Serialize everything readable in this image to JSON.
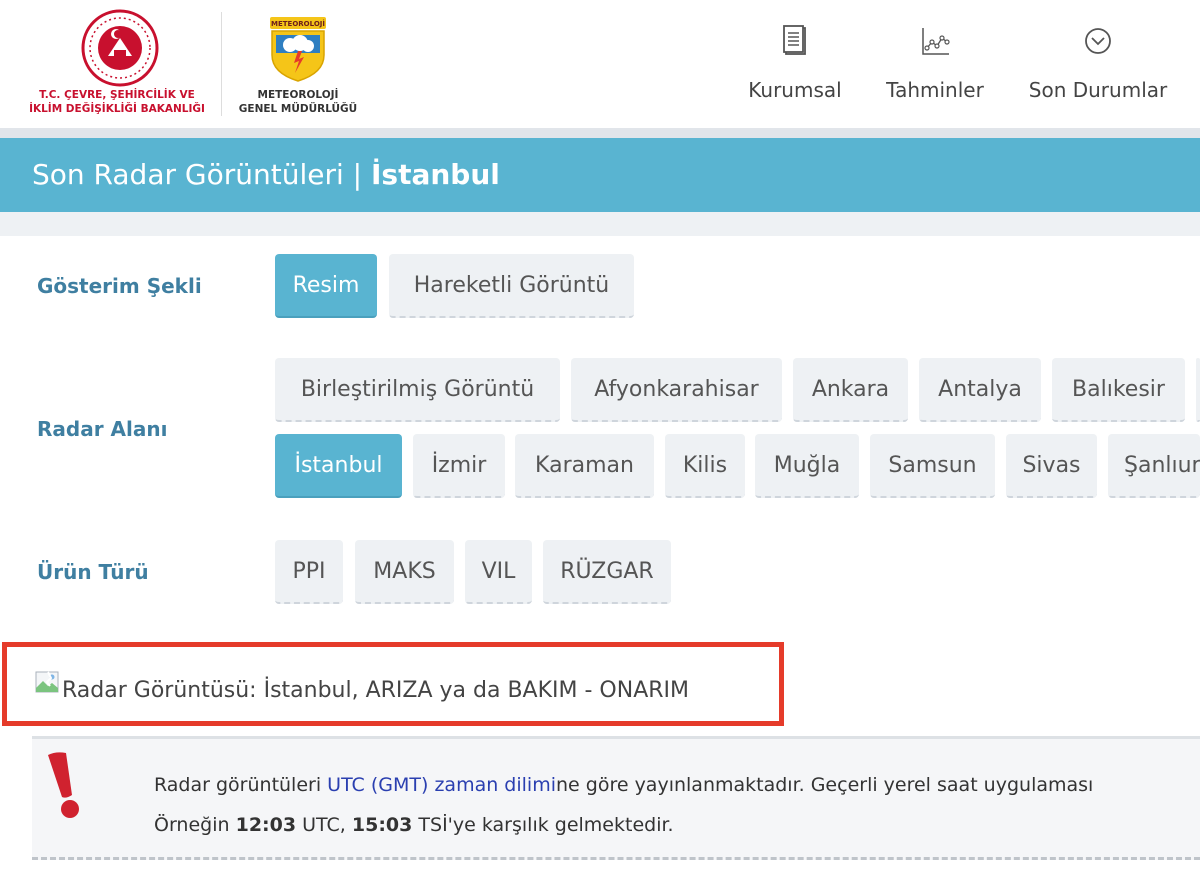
{
  "header": {
    "ministry_name_line1": "T.C. ÇEVRE, ŞEHİRCİLİK VE",
    "ministry_name_line2": "İKLİM DEĞİŞİKLİĞİ BAKANLIĞI",
    "mgm_logo_text": "METEOROLOJİ",
    "mgm_name_line1": "METEOROLOJİ",
    "mgm_name_line2": "GENEL MÜDÜRLÜĞÜ",
    "nav": [
      {
        "label": "Kurumsal",
        "icon": "document-icon"
      },
      {
        "label": "Tahminler",
        "icon": "chart-icon"
      },
      {
        "label": "Son Durumlar",
        "icon": "chevron-circle-icon"
      }
    ]
  },
  "title": {
    "prefix": "Son Radar Görüntüleri",
    "separator": "|",
    "city": "İstanbul"
  },
  "display_mode": {
    "label": "Gösterim Şekli",
    "options": [
      "Resim",
      "Hareketli Görüntü"
    ],
    "selected": "Resim"
  },
  "radar_area": {
    "label": "Radar Alanı",
    "row1": [
      "Birleştirilmiş Görüntü",
      "Afyonkarahisar",
      "Ankara",
      "Antalya",
      "Balıkesir"
    ],
    "row2": [
      "İstanbul",
      "İzmir",
      "Karaman",
      "Kilis",
      "Muğla",
      "Samsun",
      "Sivas",
      "Şanlıurfa"
    ],
    "selected": "İstanbul"
  },
  "product_type": {
    "label": "Ürün Türü",
    "options": [
      "PPI",
      "MAKS",
      "VIL",
      "RÜZGAR"
    ]
  },
  "radar_image": {
    "alt_text": "Radar Görüntüsü: İstanbul, ARIZA ya da BAKIM - ONARIM"
  },
  "notice": {
    "line1_a": "Radar görüntüleri ",
    "line1_link": "UTC (GMT) zaman dilimi",
    "line1_b": "ne göre yayınlanmaktadır. Geçerli yerel saat uygulaması",
    "line2_a": "Örneğin ",
    "line2_b1": "12:03",
    "line2_c": " UTC, ",
    "line2_b2": "15:03",
    "line2_d": " TSİ'ye karşılık gelmektedir."
  },
  "colors": {
    "accent": "#59b4d1",
    "label": "#3f7fa1",
    "highlight_border": "#e53b2a",
    "brand_red": "#c8102e"
  }
}
